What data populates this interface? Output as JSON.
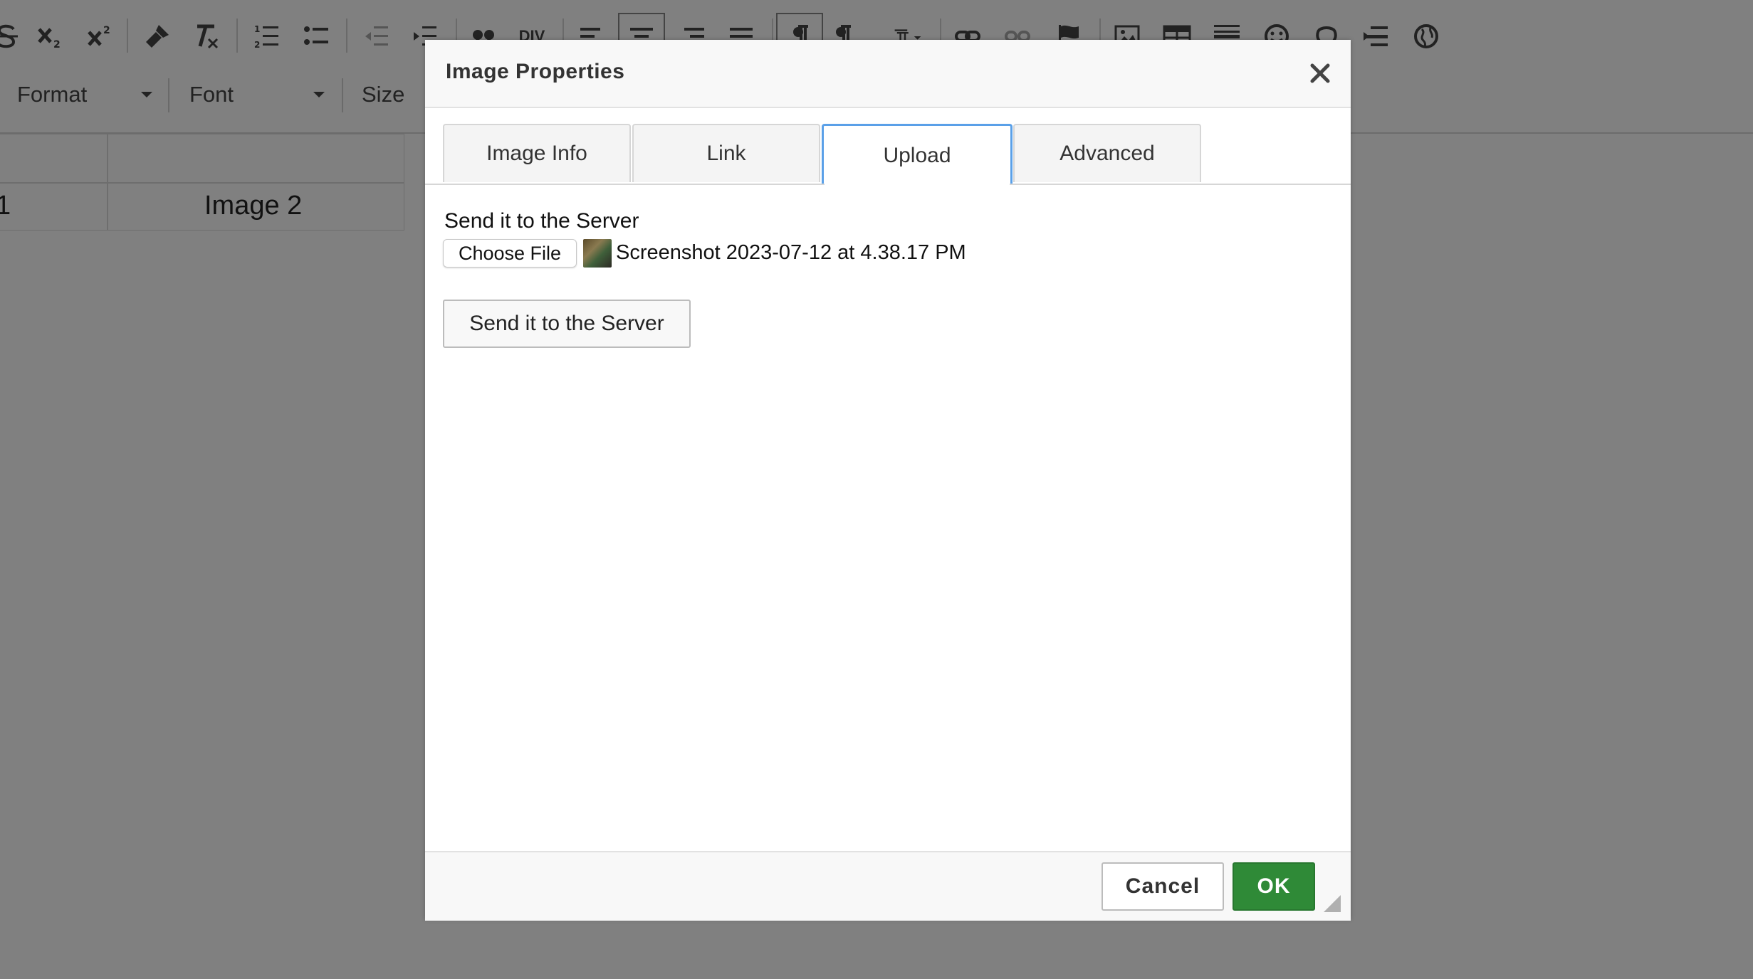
{
  "editor": {
    "toolbar_icons": [
      "strikethrough-icon",
      "subscript-icon",
      "superscript-icon",
      "copy-format-icon",
      "remove-format-icon",
      "numbered-list-icon",
      "bulleted-list-icon",
      "decrease-indent-icon",
      "increase-indent-icon",
      "blockquote-icon",
      "div-container-icon",
      "align-left-icon",
      "align-center-icon",
      "align-right-icon",
      "justify-icon",
      "text-direction-ltr-icon",
      "text-direction-rtl-icon",
      "language-icon",
      "link-icon",
      "unlink-icon",
      "anchor-icon",
      "image-icon",
      "table-icon",
      "horizontal-line-icon",
      "smiley-icon",
      "special-character-icon",
      "page-break-icon",
      "iframe-icon"
    ],
    "div_label": "DIV",
    "format_label": "Format",
    "font_label": "Font",
    "size_label": "Size",
    "cell_partial": "1",
    "cell_image2": "Image 2"
  },
  "dialog": {
    "title": "Image Properties",
    "tabs": [
      {
        "label": "Image Info"
      },
      {
        "label": "Link"
      },
      {
        "label": "Upload"
      },
      {
        "label": "Advanced"
      }
    ],
    "active_tab": "Upload",
    "upload": {
      "section_label": "Send it to the Server",
      "choose_file_label": "Choose File",
      "selected_file": "Screenshot 2023-07-12 at 4.38.17 PM",
      "send_button": "Send it to the Server"
    },
    "footer": {
      "cancel": "Cancel",
      "ok": "OK"
    }
  },
  "colors": {
    "overlay": "#808080",
    "active_tab_border": "#5aa0e8",
    "ok_button": "#2f8a37"
  }
}
